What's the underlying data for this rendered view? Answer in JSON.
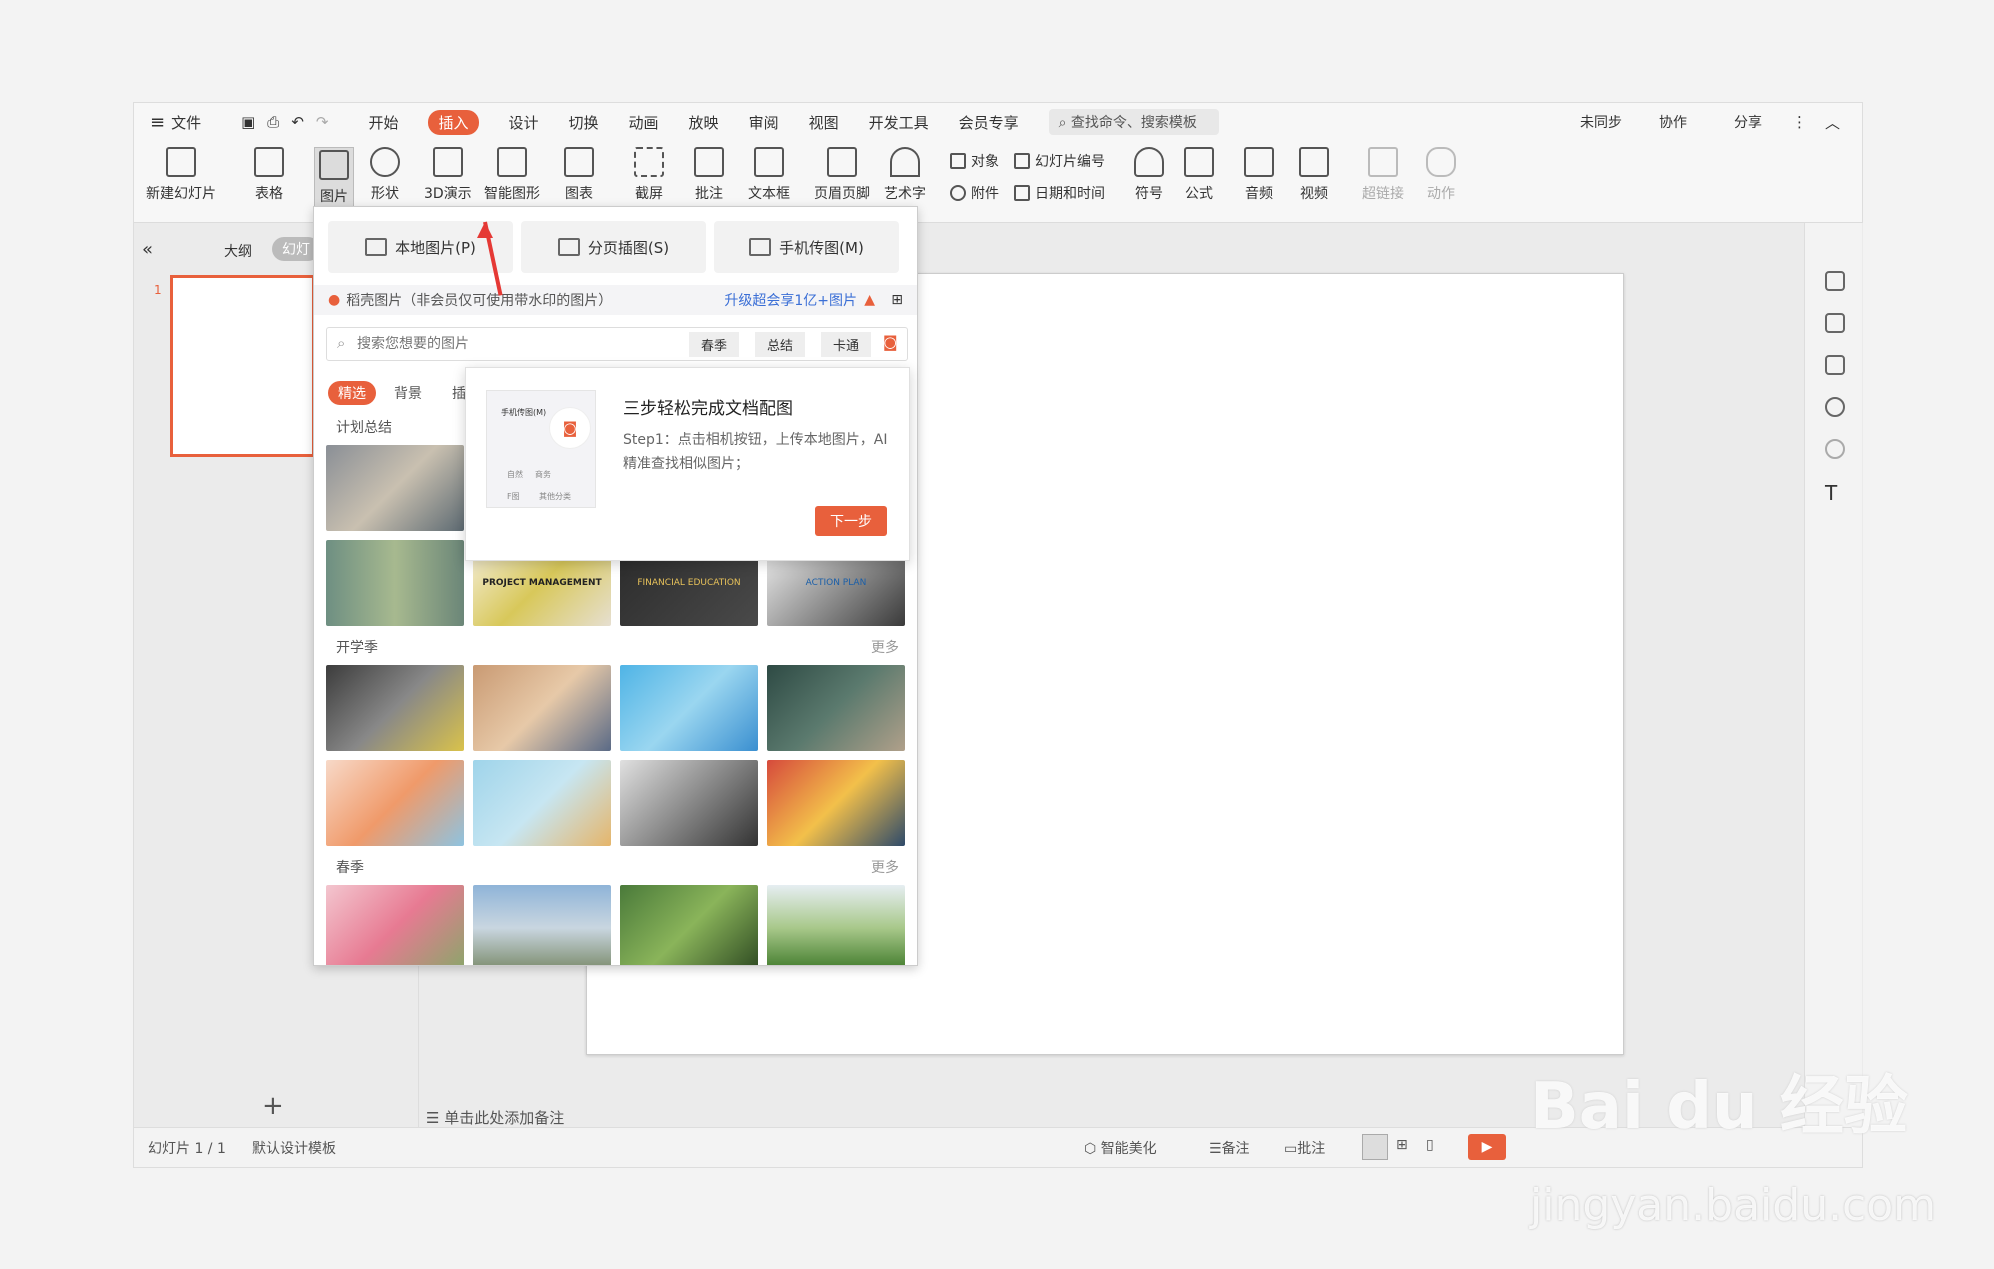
{
  "menubar": {
    "file": "文件",
    "items": [
      "开始",
      "插入",
      "设计",
      "切换",
      "动画",
      "放映",
      "审阅",
      "视图",
      "开发工具",
      "会员专享"
    ],
    "search_placeholder": "查找命令、搜索模板",
    "right": [
      "未同步",
      "协作",
      "分享"
    ]
  },
  "ribbon": {
    "buttons": [
      "新建幻灯片",
      "表格",
      "图片",
      "形状",
      "3D演示",
      "智能图形",
      "图表",
      "截屏",
      "批注",
      "文本框",
      "页眉页脚",
      "艺术字",
      "符号",
      "公式",
      "音频",
      "视频",
      "超链接",
      "动作"
    ],
    "small": [
      "对象",
      "附件",
      "幻灯片编号",
      "日期和时间"
    ]
  },
  "leftpane": {
    "tab_outline": "大纲",
    "tab_slides": "幻灯",
    "slide_number": "1"
  },
  "notes": "单击此处添加备注",
  "statusbar": {
    "slide": "幻灯片 1 / 1",
    "template": "默认设计模板",
    "beautify": "智能美化",
    "notes": "备注",
    "comments": "批注"
  },
  "popup": {
    "buttons": [
      "本地图片(P)",
      "分页插图(S)",
      "手机传图(M)"
    ],
    "source": "稻壳图片（非会员仅可使用带水印的图片）",
    "upgrade": "升级超会享1亿+图片",
    "search_placeholder": "搜索您想要的图片",
    "tags": [
      "春季",
      "总结",
      "卡通"
    ],
    "tabs": [
      "精选",
      "背景",
      "插"
    ],
    "sections": [
      "计划总结",
      "开学季",
      "春季"
    ],
    "more": "更多",
    "image_texts": [
      "PROJECT MANAGEMENT",
      "FINANCIAL EDUCATION",
      "ACTION PLAN"
    ]
  },
  "guide": {
    "title": "三步轻松完成文档配图",
    "body": "Step1：点击相机按钮，上传本地图片，AI精准查找相似图片；",
    "next": "下一步",
    "mini_labels": [
      "手机传图(M)",
      "自然",
      "商务",
      "F图",
      "其他分类"
    ]
  },
  "watermark": {
    "logo": "Bai du 经验",
    "url": "jingyan.baidu.com"
  },
  "colors": {
    "accent": "#e8603c"
  }
}
